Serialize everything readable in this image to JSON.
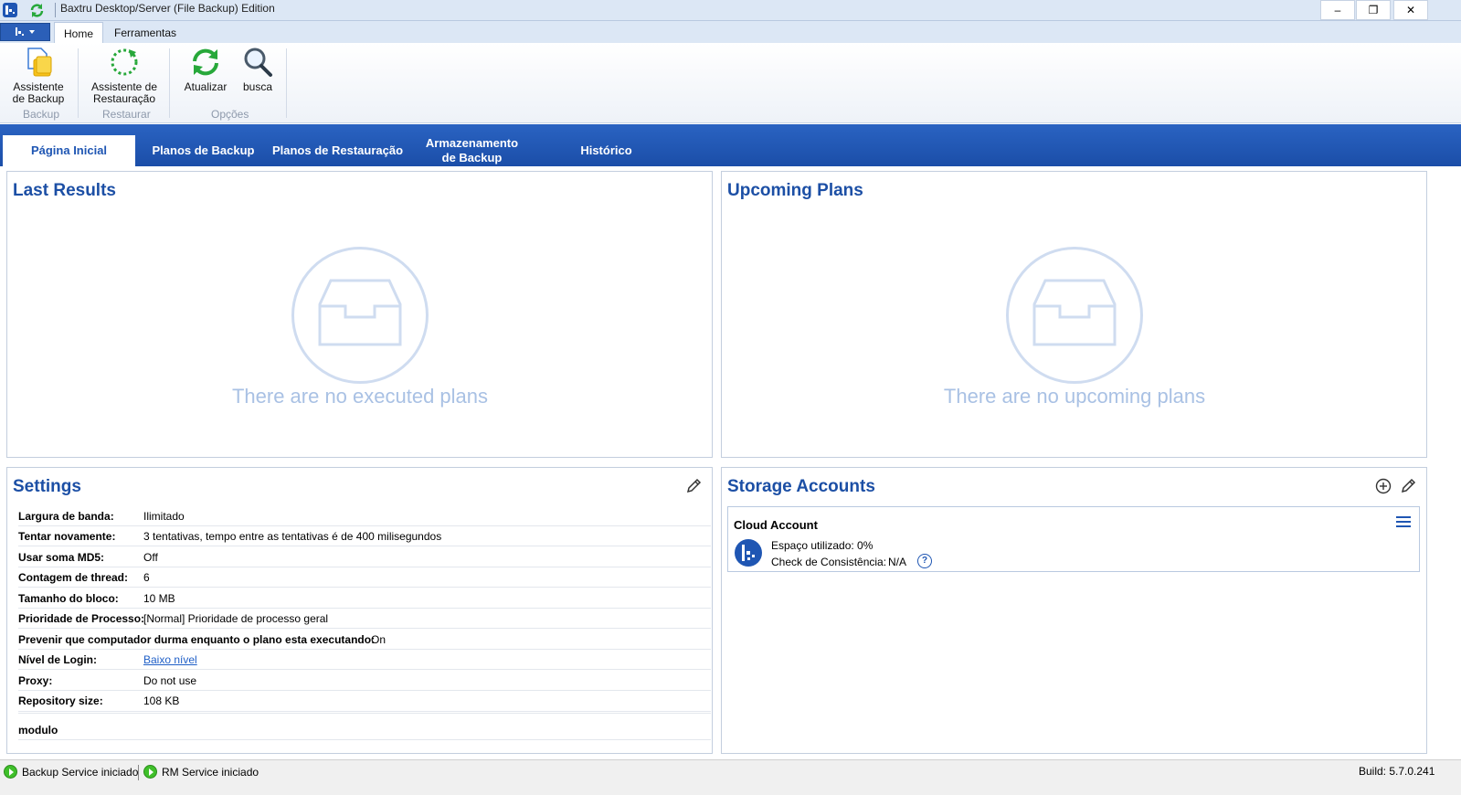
{
  "window": {
    "title": "Baxtru Desktop/Server (File Backup) Edition",
    "minimize": "–",
    "restore": "❐",
    "close": "✕"
  },
  "ribbon": {
    "tabs": [
      {
        "label": "Home",
        "active": true
      },
      {
        "label": "Ferramentas",
        "active": false
      }
    ],
    "buttons": {
      "backup_wizard": "Assistente de Backup",
      "restore_wizard": "Assistente de Restauração",
      "refresh": "Atualizar",
      "search": "busca"
    },
    "groups": {
      "backup": "Backup",
      "restore": "Restaurar",
      "options": "Opções"
    }
  },
  "nav": {
    "tabs": [
      {
        "label": "Página Inicial",
        "active": true
      },
      {
        "label": "Planos de Backup",
        "active": false
      },
      {
        "label": "Planos de Restauração",
        "active": false
      },
      {
        "label": "Armazenamento de Backup",
        "active": false
      },
      {
        "label": "Histórico",
        "active": false
      }
    ]
  },
  "last_results": {
    "title": "Last Results",
    "empty": "There are no executed plans"
  },
  "upcoming_plans": {
    "title": "Upcoming Plans",
    "empty": "There are no upcoming plans"
  },
  "settings": {
    "title": "Settings",
    "rows": [
      {
        "key": "Largura de banda:",
        "value": "Ilimitado"
      },
      {
        "key": "Tentar novamente:",
        "value": "3  tentativas, tempo entre as tentativas é de 400 milisegundos"
      },
      {
        "key": "Usar soma MD5:",
        "value": "Off"
      },
      {
        "key": "Contagem de thread:",
        "value": "6"
      },
      {
        "key": "Tamanho do bloco:",
        "value": "10 MB"
      },
      {
        "key": "Prioridade de Processo:",
        "value": "[Normal] Prioridade de processo geral"
      },
      {
        "key": "Prevenir que computador durma enquanto o plano esta executando:",
        "value": "On"
      },
      {
        "key": "Nível de Login:",
        "value": "Baixo nível"
      },
      {
        "key": "Proxy:",
        "value": "Do not use"
      },
      {
        "key": "Repository size:",
        "value": "108 KB"
      }
    ],
    "module_label": "modulo"
  },
  "storage": {
    "title": "Storage Accounts",
    "account": {
      "name": "Cloud Account",
      "space_used": "Espaço utilizado: 0%",
      "consistency_label": "Check de Consistência:",
      "consistency_value": "N/A",
      "help": "?"
    }
  },
  "status": {
    "backup_service": "Backup Service iniciado",
    "rm_service": "RM Service iniciado",
    "build": "Build: 5.7.0.241"
  },
  "colors": {
    "accent": "#1f56b3",
    "title_blue": "#1c4fa5",
    "empty_text": "#a9c1e4",
    "status_green": "#3fbf2a"
  }
}
